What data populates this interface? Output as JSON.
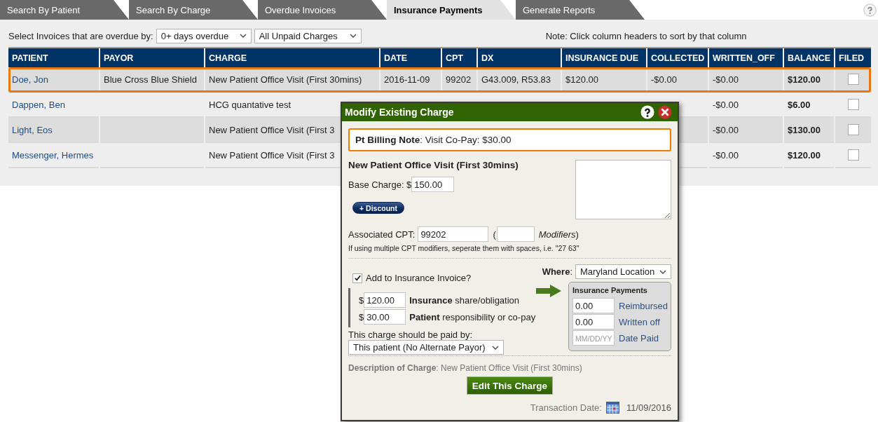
{
  "tabs": [
    {
      "label": "Search By Patient",
      "selected": false
    },
    {
      "label": "Search By Charge",
      "selected": false
    },
    {
      "label": "Overdue Invoices",
      "selected": false
    },
    {
      "label": "Insurance Payments",
      "selected": true
    },
    {
      "label": "Generate Reports",
      "selected": false
    }
  ],
  "filters": {
    "label": "Select Invoices that are overdue by:",
    "overdue": "0+ days overdue",
    "charges": "All Unpaid Charges",
    "note": "Note: Click column headers to sort by that column"
  },
  "table": {
    "columns": [
      "PATIENT",
      "PAYOR",
      "CHARGE",
      "DATE",
      "CPT",
      "DX",
      "INSURANCE DUE",
      "COLLECTED",
      "WRITTEN_OFF",
      "BALANCE",
      "FILED"
    ],
    "rows": [
      {
        "selected": true,
        "patient": "Doe, Jon",
        "payor": "Blue Cross Blue Shield",
        "charge": "New Patient Office Visit (First 30mins)",
        "date": "2016-11-09",
        "cpt": "99202",
        "dx": "G43.009, R53.83",
        "insurance_due": "$120.00",
        "collected": "-$0.00",
        "written_off": "-$0.00",
        "balance": "$120.00",
        "filed": false
      },
      {
        "selected": false,
        "patient": "Dappen, Ben",
        "charge": "HCG quantative test",
        "written_off": "-$0.00",
        "balance": "$6.00",
        "filed": false
      },
      {
        "selected": false,
        "patient": "Light, Eos",
        "charge": "New Patient Office Visit (First 3",
        "written_off": "-$0.00",
        "balance": "$130.00",
        "filed": false
      },
      {
        "selected": false,
        "patient": "Messenger, Hermes",
        "charge": "New Patient Office Visit (First 3",
        "written_off": "-$0.00",
        "balance": "$120.00",
        "filed": false
      }
    ]
  },
  "modal": {
    "title": "Modify Existing Charge",
    "billing_note": "**Pt Billing Note**: Visit Co-Pay: $30.00",
    "charge_name": "New Patient Office Visit (First 30mins)",
    "base_charge": {
      "label": "Base Charge: $",
      "value": "150.00"
    },
    "discount_button": "+ Discount",
    "cpt": {
      "label": "Associated CPT:",
      "value": "99202",
      "open_paren": "(",
      "modifiers_label": "*Modifiers*)"
    },
    "cpt_hint": "If using multiple CPT modifiers, seperate them with spaces, i.e. \"27 63\"",
    "add_to_invoice": {
      "label": "Add to Insurance Invoice?",
      "checked": true
    },
    "shares": [
      {
        "currency": "$",
        "value": "120.00",
        "label": "**Insurance** share/obligation"
      },
      {
        "currency": "$",
        "value": "30.00",
        "label": "**Patient** responsibility or co-pay"
      }
    ],
    "paid_by": {
      "label": "This charge should be paid by:",
      "value": "This patient (No Alternate Payor)"
    },
    "where": {
      "label": "**Where**:",
      "value": "Maryland Location"
    },
    "insurance_payments": {
      "title": "Insurance Payments",
      "fields": [
        {
          "value": "0.00",
          "label": "Reimbursed"
        },
        {
          "value": "0.00",
          "label": "Written off"
        },
        {
          "placeholder": "MM/DD/YY",
          "label": "Date Paid"
        }
      ]
    },
    "description": "**Description of Charge**: New Patient Office Visit (First 30mins)",
    "edit_button": "Edit This Charge",
    "transaction_date": {
      "label": "Transaction Date:",
      "value": "11/09/2016"
    }
  }
}
